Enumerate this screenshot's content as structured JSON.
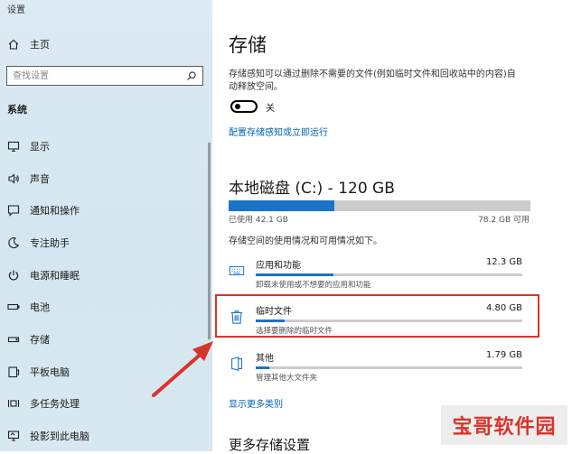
{
  "window": {
    "title": "设置"
  },
  "sidebar": {
    "home_label": "主页",
    "search": {
      "placeholder": "查找设置",
      "icon": "search-icon"
    },
    "section_label": "系统",
    "items": [
      {
        "label": "显示",
        "icon": "monitor-icon"
      },
      {
        "label": "声音",
        "icon": "speaker-icon"
      },
      {
        "label": "通知和操作",
        "icon": "notification-icon"
      },
      {
        "label": "专注助手",
        "icon": "moon-icon"
      },
      {
        "label": "电源和睡眠",
        "icon": "power-icon"
      },
      {
        "label": "电池",
        "icon": "battery-icon"
      },
      {
        "label": "存储",
        "icon": "storage-icon"
      },
      {
        "label": "平板电脑",
        "icon": "tablet-icon"
      },
      {
        "label": "多任务处理",
        "icon": "multitask-icon"
      },
      {
        "label": "投影到此电脑",
        "icon": "project-icon"
      }
    ]
  },
  "main": {
    "title": "存储",
    "storage_sense_desc": "存储感知可以通过删除不需要的文件(例如临时文件和回收站中的内容)自动释放空间。",
    "toggle": {
      "state_label": "关",
      "on": false
    },
    "config_link": "配置存储感知或立即运行",
    "disk": {
      "title": "本地磁盘 (C:) - 120 GB",
      "used": "已使用 42.1 GB",
      "available": "78.2 GB 可用",
      "used_fraction": 0.35
    },
    "usage_desc": "存储空间的使用情况和可用情况如下。",
    "categories": [
      {
        "name": "应用和功能",
        "size": "12.3 GB",
        "desc": "卸载未使用或不想要的应用和功能",
        "fraction": 0.29,
        "icon": "keyboard-icon"
      },
      {
        "name": "临时文件",
        "size": "4.80 GB",
        "desc": "选择要删除的临时文件",
        "fraction": 0.11,
        "icon": "trash-icon"
      },
      {
        "name": "其他",
        "size": "1.79 GB",
        "desc": "管理其他大文件夹",
        "fraction": 0.05,
        "icon": "folder-icon"
      }
    ],
    "show_more_link": "显示更多类别",
    "more_settings_heading": "更多存储设置"
  },
  "watermark": {
    "text": "宝哥软件园"
  },
  "colors": {
    "accent": "#1a73c7",
    "highlight": "#d9342b",
    "link": "#0063b1"
  }
}
